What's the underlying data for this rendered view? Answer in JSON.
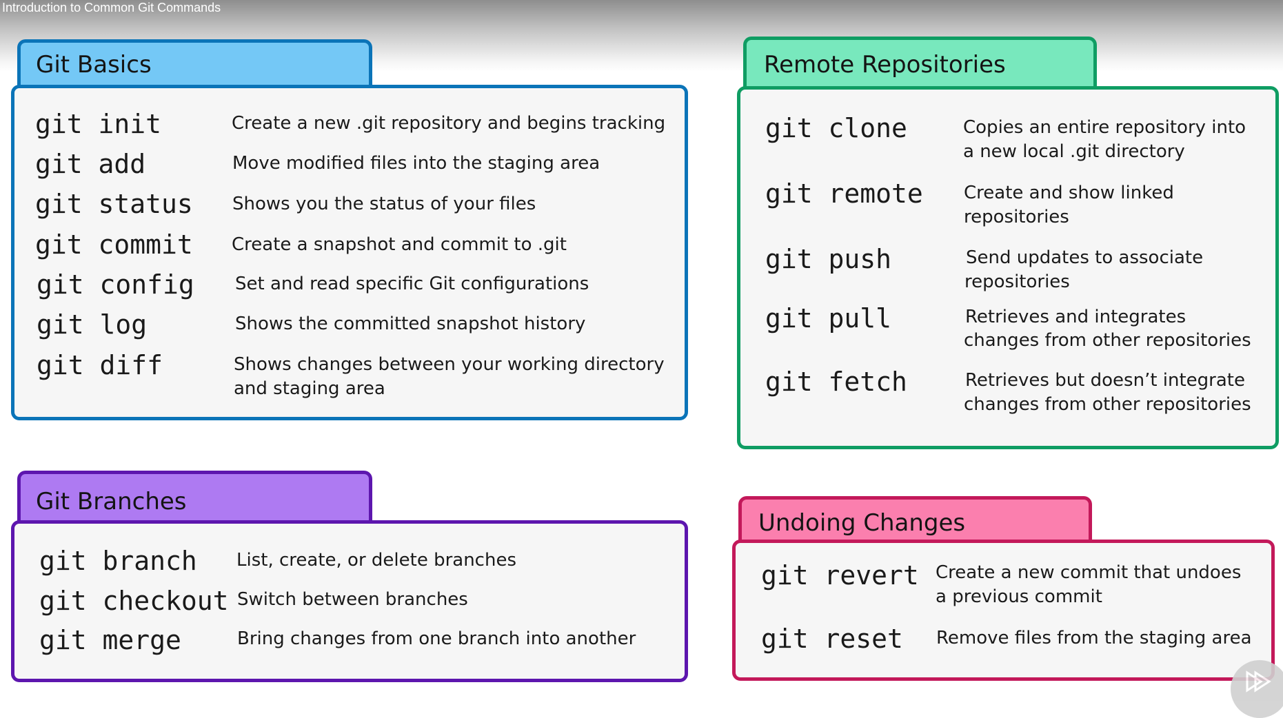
{
  "video": {
    "title": "Introduction to Common Git Commands"
  },
  "colors": {
    "basics_border": "#0b74b8",
    "basics_tab": "#74c8f6",
    "remote_border": "#0f9d63",
    "remote_tab": "#78e8bd",
    "branches_border": "#5d16ae",
    "branches_tab": "#ae7af2",
    "undo_border": "#c3195a",
    "undo_tab": "#fb7fae"
  },
  "sections": {
    "basics": {
      "title": "Git Basics",
      "commands": [
        {
          "cmd": "git init",
          "desc": [
            "Create a new .git repository and begins tracking"
          ]
        },
        {
          "cmd": "git add",
          "desc": [
            "Move modified files into the staging area"
          ]
        },
        {
          "cmd": "git status",
          "desc": [
            "Shows you the status of your files"
          ]
        },
        {
          "cmd": "git commit",
          "desc": [
            "Create a snapshot and commit to .git"
          ]
        },
        {
          "cmd": "git config",
          "desc": [
            "Set and read specific Git configurations"
          ]
        },
        {
          "cmd": "git log",
          "desc": [
            "Shows the committed snapshot history"
          ]
        },
        {
          "cmd": "git diff",
          "desc": [
            "Shows changes between your working directory",
            "and staging area"
          ]
        }
      ]
    },
    "remote": {
      "title": "Remote Repositories",
      "commands": [
        {
          "cmd": "git clone",
          "desc": [
            "Copies an entire repository into",
            "a new local .git directory"
          ]
        },
        {
          "cmd": "git remote",
          "desc": [
            "Create and show linked",
            "repositories"
          ]
        },
        {
          "cmd": "git push",
          "desc": [
            "Send updates to associate",
            "repositories"
          ]
        },
        {
          "cmd": "git pull",
          "desc": [
            "Retrieves and integrates",
            "changes from other repositories"
          ]
        },
        {
          "cmd": "git fetch",
          "desc": [
            "Retrieves but doesn’t integrate",
            "changes from other repositories"
          ]
        }
      ]
    },
    "branches": {
      "title": "Git Branches",
      "commands": [
        {
          "cmd": "git branch",
          "desc": [
            "List, create, or delete branches"
          ]
        },
        {
          "cmd": "git checkout",
          "desc": [
            "Switch between branches"
          ]
        },
        {
          "cmd": "git merge",
          "desc": [
            "Bring changes from one branch into another"
          ]
        }
      ]
    },
    "undo": {
      "title": "Undoing Changes",
      "commands": [
        {
          "cmd": "git revert",
          "desc": [
            "Create a new commit that undoes",
            "a previous commit"
          ]
        },
        {
          "cmd": "git reset",
          "desc": [
            "Remove files from the staging area"
          ]
        }
      ]
    }
  },
  "player": {
    "play_icon": "play-icon"
  }
}
